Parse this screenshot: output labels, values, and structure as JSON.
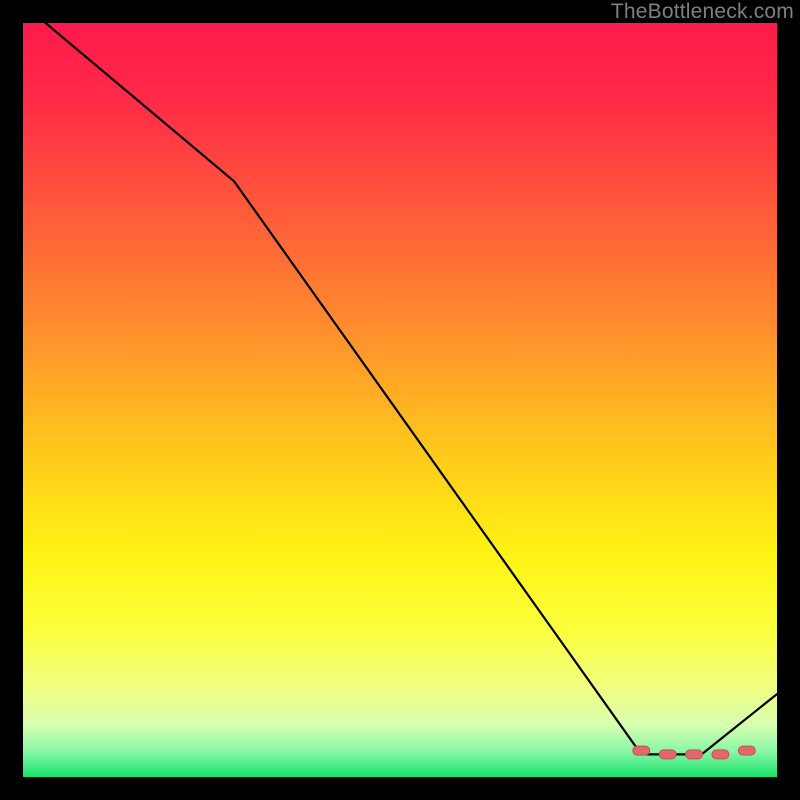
{
  "watermark": "TheBottleneck.com",
  "colors": {
    "gradient_stops": [
      {
        "offset": 0.0,
        "color": "#ff1a4b"
      },
      {
        "offset": 0.1,
        "color": "#ff2a48"
      },
      {
        "offset": 0.25,
        "color": "#ff5a3a"
      },
      {
        "offset": 0.4,
        "color": "#ff8c2e"
      },
      {
        "offset": 0.55,
        "color": "#ffc21e"
      },
      {
        "offset": 0.7,
        "color": "#fff213"
      },
      {
        "offset": 0.8,
        "color": "#fbff3a"
      },
      {
        "offset": 0.88,
        "color": "#f2ff80"
      },
      {
        "offset": 0.93,
        "color": "#d8ffb0"
      },
      {
        "offset": 0.965,
        "color": "#8cf7a8"
      },
      {
        "offset": 1.0,
        "color": "#19e36e"
      }
    ],
    "line": "#000000",
    "marker_fill": "#e06a6a",
    "marker_stroke": "#c94f4f"
  },
  "chart_data": {
    "type": "line",
    "title": "",
    "xlabel": "",
    "ylabel": "",
    "xlim": [
      0,
      100
    ],
    "ylim": [
      0,
      100
    ],
    "grid": false,
    "legend": false,
    "series": [
      {
        "name": "curve",
        "x": [
          3,
          28,
          82,
          90,
          100
        ],
        "y": [
          100,
          79,
          3,
          3,
          11
        ]
      }
    ],
    "markers": {
      "name": "optimal-region",
      "x": [
        82,
        85.5,
        89,
        92.5,
        96
      ],
      "y": [
        3.5,
        3,
        3,
        3,
        3.5
      ]
    }
  }
}
